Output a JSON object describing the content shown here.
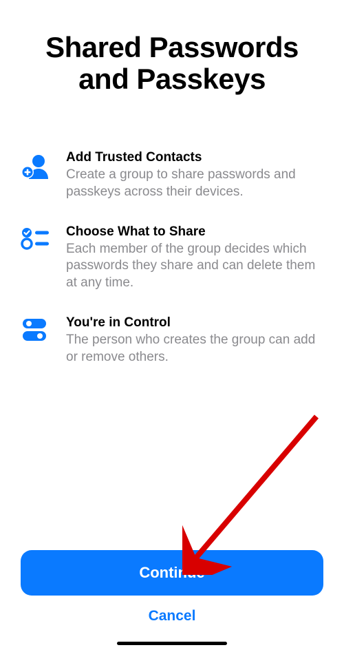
{
  "title": "Shared Passwords and Passkeys",
  "features": [
    {
      "icon": "add-person-icon",
      "heading": "Add Trusted Contacts",
      "desc": "Create a group to share passwords and passkeys across their devices."
    },
    {
      "icon": "checklist-icon",
      "heading": "Choose What to Share",
      "desc": "Each member of the group decides which passwords they share and can delete them at any time."
    },
    {
      "icon": "toggles-icon",
      "heading": "You're in Control",
      "desc": "The person who creates the group can add or remove others."
    }
  ],
  "buttons": {
    "continue": "Continue",
    "cancel": "Cancel"
  },
  "colors": {
    "accent": "#0a7aff",
    "text_secondary": "#8a8a8e"
  }
}
